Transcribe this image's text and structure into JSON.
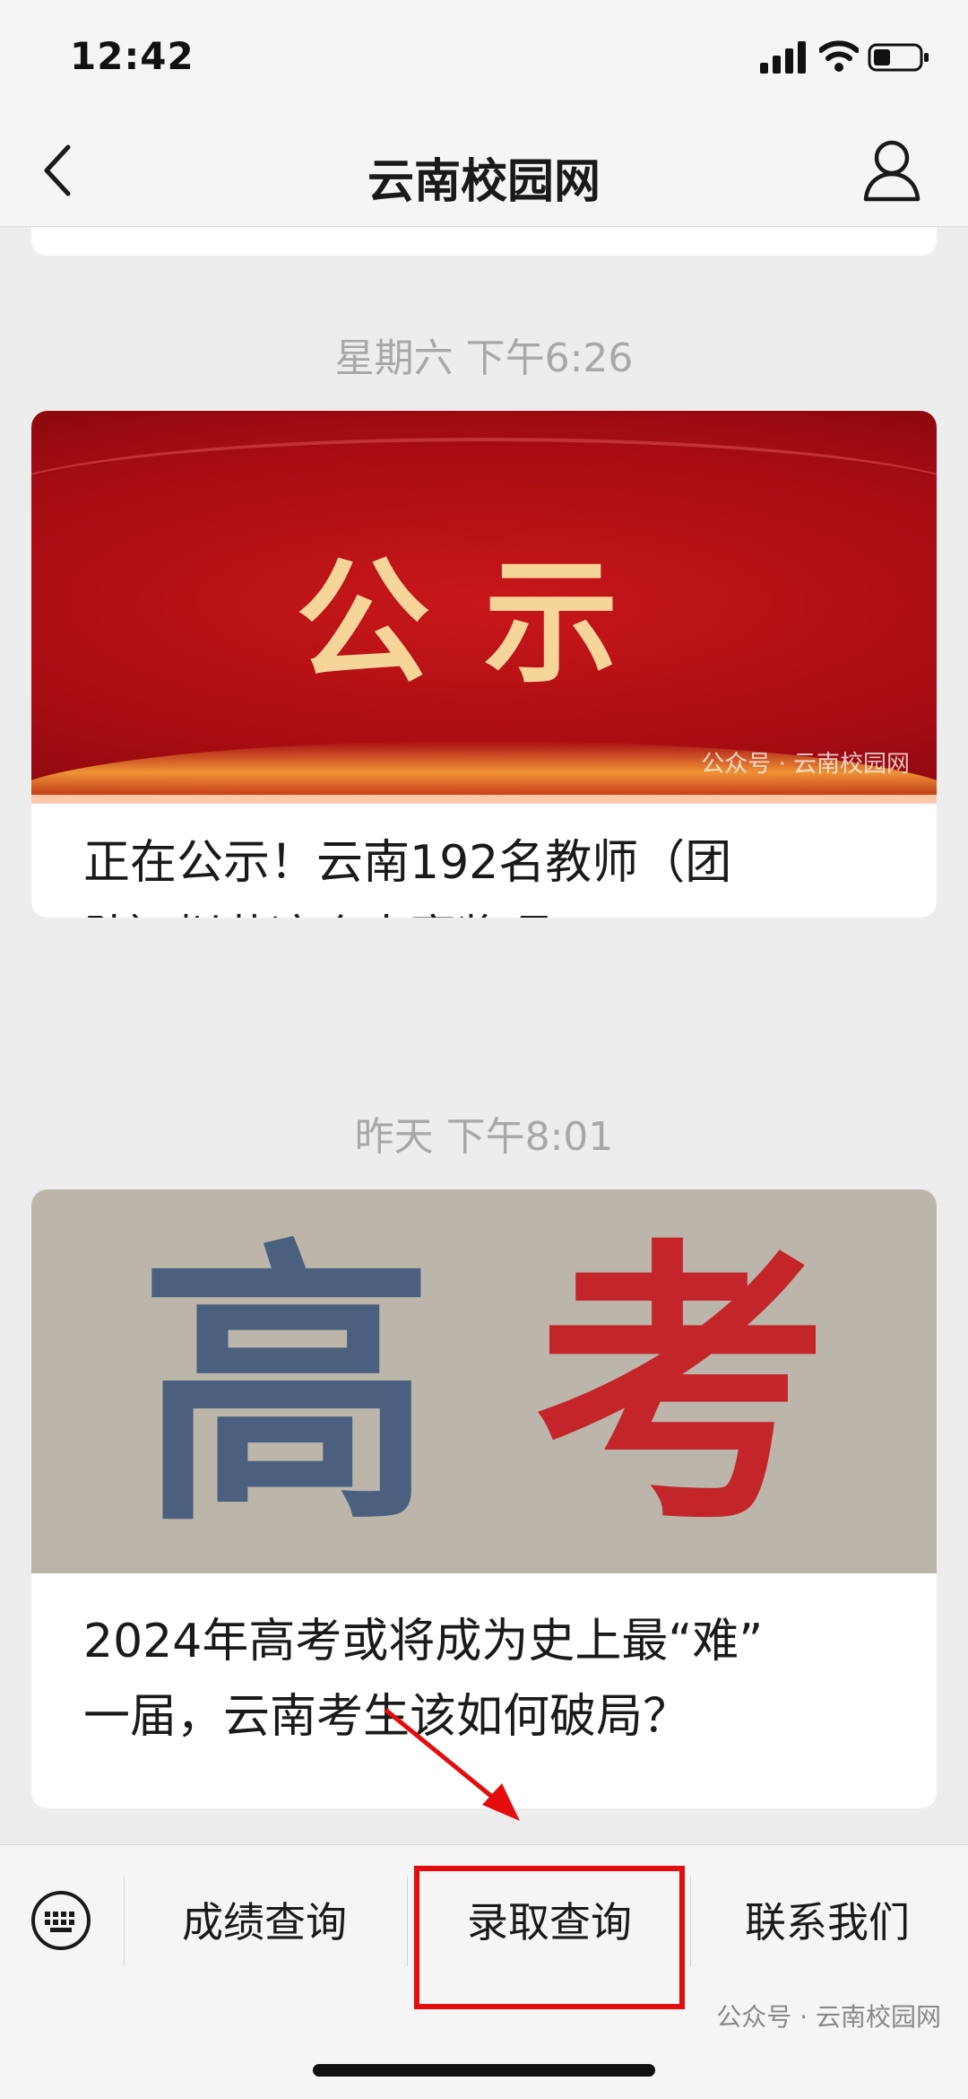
{
  "status_bar": {
    "time": "12:42"
  },
  "nav": {
    "title": "云南校园网"
  },
  "feed": {
    "items": [
      {
        "timestamp": "星期六 下午6:26",
        "image_text": "公示",
        "image_watermark": "公众号 · 云南校园网",
        "headline_line1": "正在公示！云南192名教师（团",
        "headline_line2": "队）拟获这个大赛奖项"
      },
      {
        "timestamp": "昨天 下午8:01",
        "image_char1": "高",
        "image_char2": "考",
        "headline_line1": "2024年高考或将成为史上最“难”",
        "headline_line2": "一届，云南考生该如何破局？"
      }
    ]
  },
  "menu": {
    "items": [
      {
        "label": "成绩查询"
      },
      {
        "label": "录取查询"
      },
      {
        "label": "联系我们"
      }
    ],
    "watermark": "公众号 · 云南校园网"
  },
  "colors": {
    "annotation": "#e30d0d",
    "banner_red": "#b0101a",
    "banner_gold": "#f6d59a"
  }
}
